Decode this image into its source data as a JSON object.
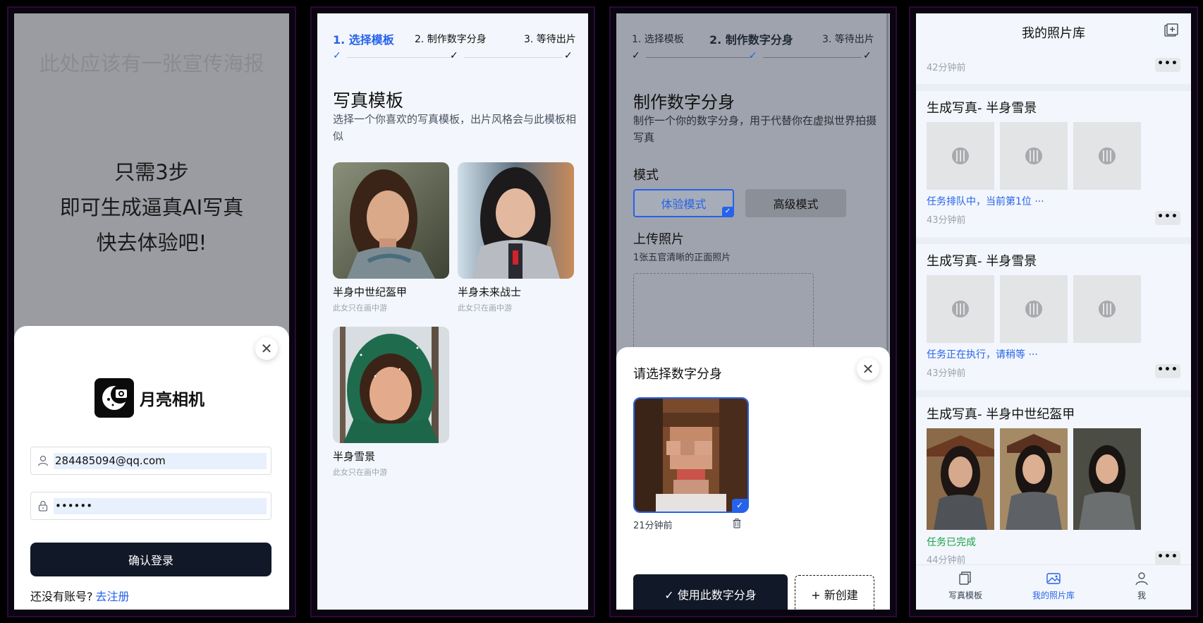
{
  "login": {
    "poster_placeholder": "此处应该有一张宣传海报",
    "slogan_line1": "只需3步",
    "slogan_line2": "即可生成逼真AI写真",
    "slogan_line3": "快去体验吧!",
    "brand_name": "月亮相机",
    "email_value": "284485094@qq.com",
    "password_value": "••••••",
    "submit_label": "确认登录",
    "register_prompt": "还没有账号?",
    "register_link": "去注册"
  },
  "steps": {
    "step1": "1. 选择模板",
    "step2": "2. 制作数字分身",
    "step3": "3. 等待出片"
  },
  "templates": {
    "title": "写真模板",
    "description": "选择一个你喜欢的写真模板，出片风格会与此模板相似",
    "items": [
      {
        "name": "半身中世纪盔甲",
        "note": "此女只在画中游"
      },
      {
        "name": "半身未来战士",
        "note": "此女只在画中游"
      },
      {
        "name": "半身雪景",
        "note": "此女只在画中游"
      }
    ]
  },
  "avatar": {
    "title": "制作数字分身",
    "description": "制作一个你的数字分身，用于代替你在虚拟世界拍摄写真",
    "mode_label": "模式",
    "mode_trial": "体验模式",
    "mode_advanced": "高级模式",
    "upload_label": "上传照片",
    "upload_hint": "1张五官清晰的正面照片",
    "sheet_title": "请选择数字分身",
    "card_time": "21分钟前",
    "use_label": "✓ 使用此数字分身",
    "new_label": "+ 新创建"
  },
  "library": {
    "title": "我的照片库",
    "first_time": "42分钟前",
    "tasks": [
      {
        "title": "生成写真- 半身雪景",
        "status": "任务排队中，当前第1位 ···",
        "time": "43分钟前"
      },
      {
        "title": "生成写真- 半身雪景",
        "status": "任务正在执行，请稍等 ···",
        "time": "43分钟前"
      },
      {
        "title": "生成写真- 半身中世纪盔甲",
        "status": "任务已完成",
        "time": "44分钟前"
      }
    ],
    "more_label": "•••",
    "tabs": [
      "写真模板",
      "我的照片库",
      "我"
    ]
  },
  "colors": {
    "accent": "#2563eb",
    "dark_button": "#111827",
    "success": "#16a34a"
  }
}
